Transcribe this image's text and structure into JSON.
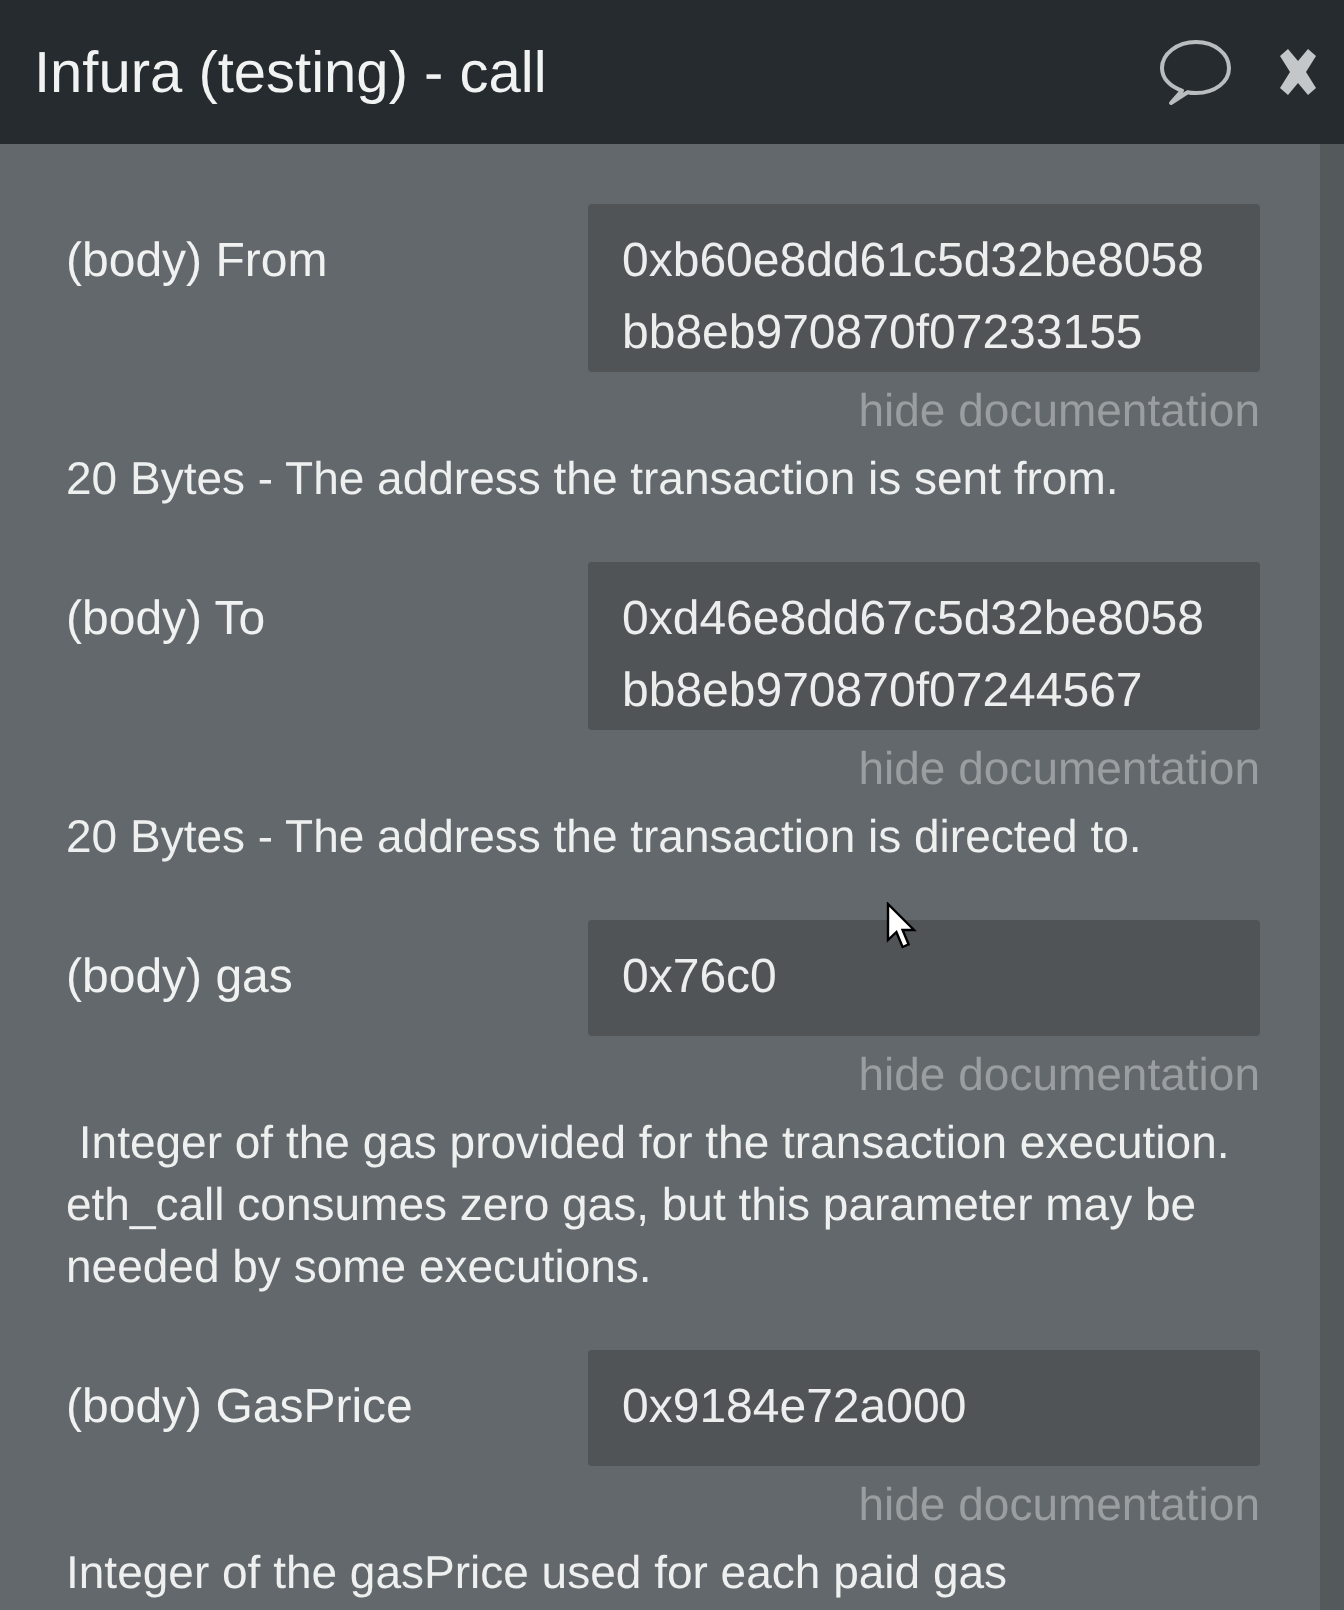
{
  "window": {
    "title": "Infura (testing) - call"
  },
  "params": [
    {
      "label": "(body) From",
      "value": "0xb60e8dd61c5d32be8058bb8eb970870f07233155",
      "doc_toggle": "hide documentation",
      "description": "20 Bytes - The address the transaction is sent from."
    },
    {
      "label": "(body) To",
      "value": "0xd46e8dd67c5d32be8058bb8eb970870f07244567",
      "doc_toggle": "hide documentation",
      "description": "20 Bytes - The address the transaction is directed to."
    },
    {
      "label": "(body) gas",
      "value": "0x76c0",
      "doc_toggle": "hide documentation",
      "description": " Integer of the gas provided for the transaction execution. eth_call consumes zero gas, but this parameter may be needed by some executions."
    },
    {
      "label": "(body) GasPrice",
      "value": "0x9184e72a000",
      "doc_toggle": "hide documentation",
      "description": "Integer of the gasPrice used for each paid gas"
    }
  ]
}
